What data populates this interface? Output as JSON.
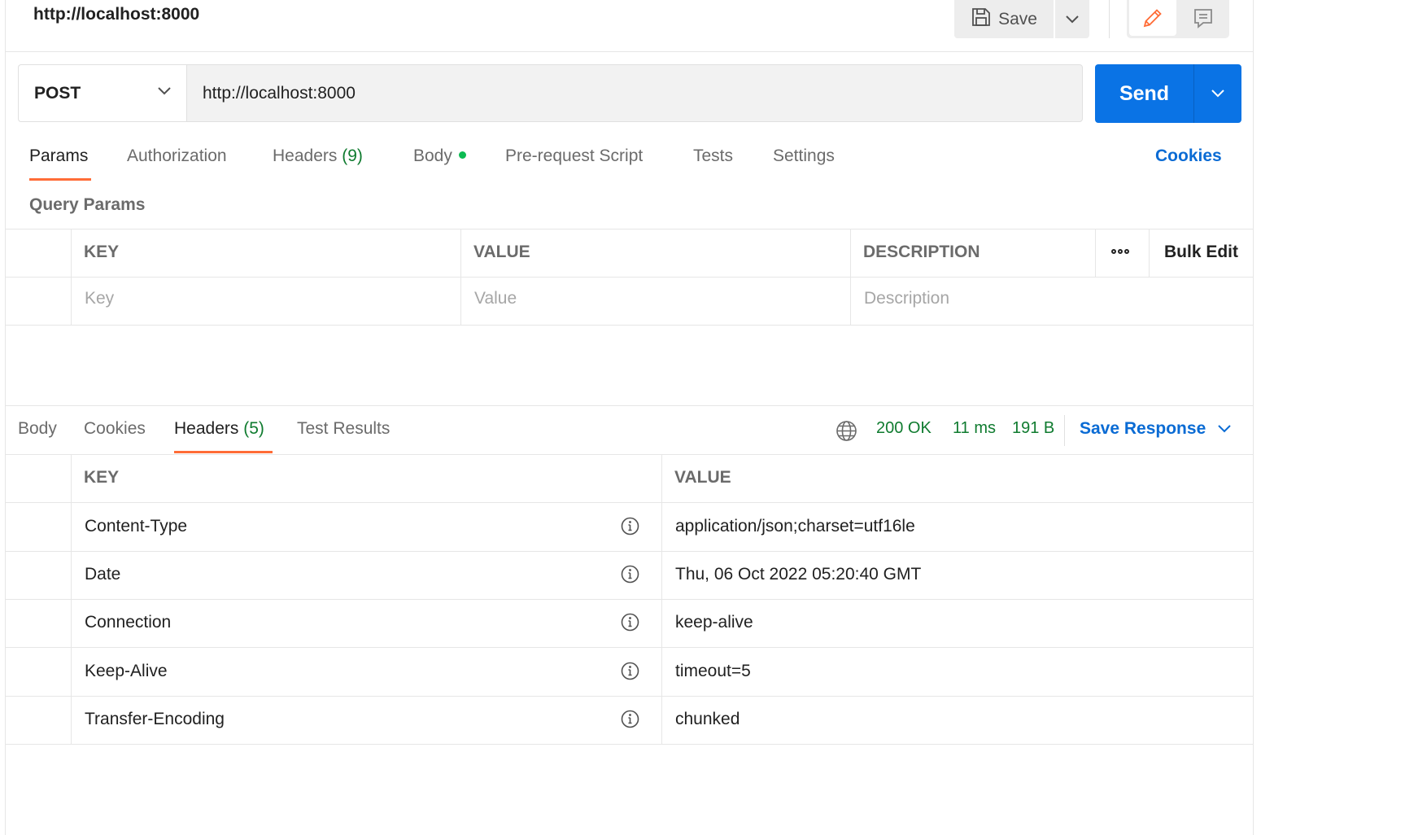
{
  "header": {
    "title": "http://localhost:8000",
    "save_label": "Save"
  },
  "request": {
    "method": "POST",
    "url": "http://localhost:8000",
    "send_label": "Send"
  },
  "request_tabs": [
    {
      "label": "Params",
      "count": ""
    },
    {
      "label": "Authorization",
      "count": ""
    },
    {
      "label": "Headers",
      "count": "(9)"
    },
    {
      "label": "Body",
      "count": ""
    },
    {
      "label": "Pre-request Script",
      "count": ""
    },
    {
      "label": "Tests",
      "count": ""
    },
    {
      "label": "Settings",
      "count": ""
    }
  ],
  "active_request_tab": "Params",
  "cookies_link": "Cookies",
  "query_params": {
    "title": "Query Params",
    "columns": [
      "KEY",
      "VALUE",
      "DESCRIPTION"
    ],
    "bulk_edit_label": "Bulk Edit",
    "placeholders": {
      "key": "Key",
      "value": "Value",
      "description": "Description"
    }
  },
  "response_tabs": [
    {
      "label": "Body",
      "count": ""
    },
    {
      "label": "Cookies",
      "count": ""
    },
    {
      "label": "Headers",
      "count": "(5)"
    },
    {
      "label": "Test Results",
      "count": ""
    }
  ],
  "active_response_tab": "Headers",
  "response_status": {
    "status": "200 OK",
    "time": "11 ms",
    "size": "191 B",
    "save_response_label": "Save Response"
  },
  "response_headers": {
    "columns": [
      "KEY",
      "VALUE"
    ],
    "rows": [
      {
        "key": "Content-Type",
        "value": "application/json;charset=utf16le"
      },
      {
        "key": "Date",
        "value": "Thu, 06 Oct 2022 05:20:40 GMT"
      },
      {
        "key": "Connection",
        "value": "keep-alive"
      },
      {
        "key": "Keep-Alive",
        "value": "timeout=5"
      },
      {
        "key": "Transfer-Encoding",
        "value": "chunked"
      }
    ]
  },
  "colors": {
    "accent": "#ff6c37",
    "send": "#0a73e5",
    "link": "#0a6bd4",
    "status_ok": "#0f7b2f",
    "body_dot": "#0cbb52"
  },
  "icons": [
    "save-icon",
    "chevron-down-icon",
    "pencil-icon",
    "comment-icon",
    "more-icon",
    "globe-icon",
    "info-icon"
  ]
}
